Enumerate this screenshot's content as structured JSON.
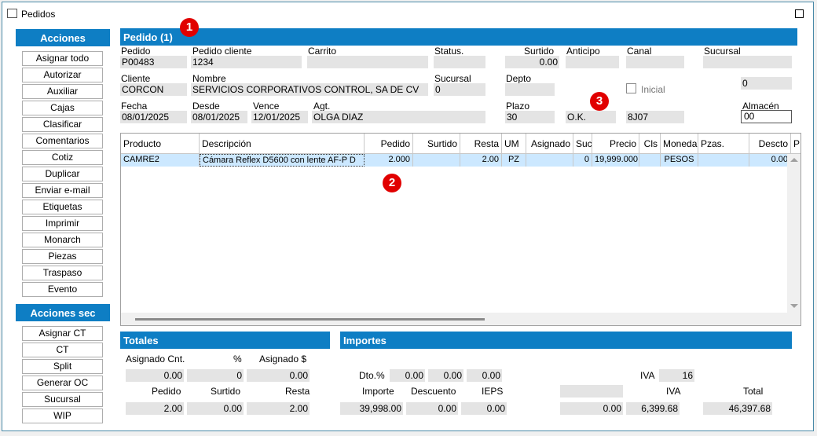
{
  "window": {
    "title": "Pedidos"
  },
  "sidebar": {
    "acciones_header": "Acciones",
    "acciones": [
      "Asignar todo",
      "Autorizar",
      "Auxiliar",
      "Cajas",
      "Clasificar",
      "Comentarios",
      "Cotiz",
      "Duplicar",
      "Enviar e-mail",
      "Etiquetas",
      "Imprimir",
      "Monarch",
      "Piezas",
      "Traspaso",
      "Evento"
    ],
    "acciones_sec_header": "Acciones sec",
    "acciones_sec": [
      "Asignar CT",
      "CT",
      "Split",
      "Generar OC",
      "Sucursal",
      "WIP"
    ]
  },
  "pedido": {
    "header": "Pedido (1)",
    "pedido_label": "Pedido",
    "pedido_value": "P00483",
    "pedido_cliente_label": "Pedido cliente",
    "pedido_cliente_value": "1234",
    "carrito_label": "Carrito",
    "carrito_value": "",
    "status_label": "Status.",
    "status_value": "",
    "surtido_label": "Surtido",
    "surtido_value": "0.00",
    "anticipo_label": "Anticipo",
    "anticipo_value": "",
    "canal_label": "Canal",
    "canal_value": "",
    "sucursal_top_label": "Sucursal",
    "sucursal_top_value": "",
    "cliente_label": "Cliente",
    "cliente_value": "CORCON",
    "nombre_label": "Nombre",
    "nombre_value": "SERVICIOS CORPORATIVOS CONTROL, SA DE CV",
    "sucursal_label": "Sucursal",
    "sucursal_value": "0",
    "depto_label": "Depto",
    "depto_value": "",
    "inicial_label": "Inicial",
    "right_value": "0",
    "fecha_label": "Fecha",
    "fecha_value": "08/01/2025",
    "desde_label": "Desde",
    "desde_value": "08/01/2025",
    "vence_label": "Vence",
    "vence_value": "12/01/2025",
    "agt_label": "Agt.",
    "agt_value": "OLGA DIAZ",
    "plazo_label": "Plazo",
    "plazo_value": "30",
    "ok_value": "O.K.",
    "code_value": "8J07",
    "almacen_label": "Almacén",
    "almacen_value": "00"
  },
  "grid": {
    "columns": [
      "Producto",
      "Descripción",
      "Pedido",
      "Surtido",
      "Resta",
      "UM",
      "Asignado",
      "Suc.",
      "Precio",
      "Cls",
      "Moneda",
      "Pzas.",
      "Descto",
      "P"
    ],
    "rows": [
      [
        "CAMRE2",
        "Cámara Reflex D5600 con lente AF-P D",
        "2.000",
        "",
        "2.00",
        "PZ",
        "",
        "0",
        "19,999.000",
        "",
        "PESOS",
        "",
        "0.00",
        ""
      ]
    ]
  },
  "totales": {
    "header": "Totales",
    "asignado_cnt_label": "Asignado Cnt.",
    "pct_label": "%",
    "asignado_usd_label": "Asignado $",
    "asignado_cnt_value": "0.00",
    "pct_value": "0",
    "asignado_usd_value": "0.00",
    "pedido_label": "Pedido",
    "surtido_label": "Surtido",
    "resta_label": "Resta",
    "pedido_value": "2.00",
    "surtido_value": "0.00",
    "resta_value": "2.00"
  },
  "importes": {
    "header": "Importes",
    "dto_label": "Dto.%",
    "dto1": "0.00",
    "dto2": "0.00",
    "dto3": "0.00",
    "iva_rate_label": "IVA",
    "iva_rate_value": "16",
    "importe_label": "Importe",
    "descuento_label": "Descuento",
    "ieps_label": "IEPS",
    "iva_label": "IVA",
    "total_label": "Total",
    "importe_value": "39,998.00",
    "descuento_value": "0.00",
    "ieps_value": "0.00",
    "blank_value": "0.00",
    "iva_value": "6,399.68",
    "total_value": "46,397.68"
  },
  "badges": [
    "1",
    "2",
    "3"
  ],
  "colors": {
    "header_blue": "#0e7ec4",
    "selected_row": "#cce8ff",
    "badge_red": "#e10000"
  }
}
